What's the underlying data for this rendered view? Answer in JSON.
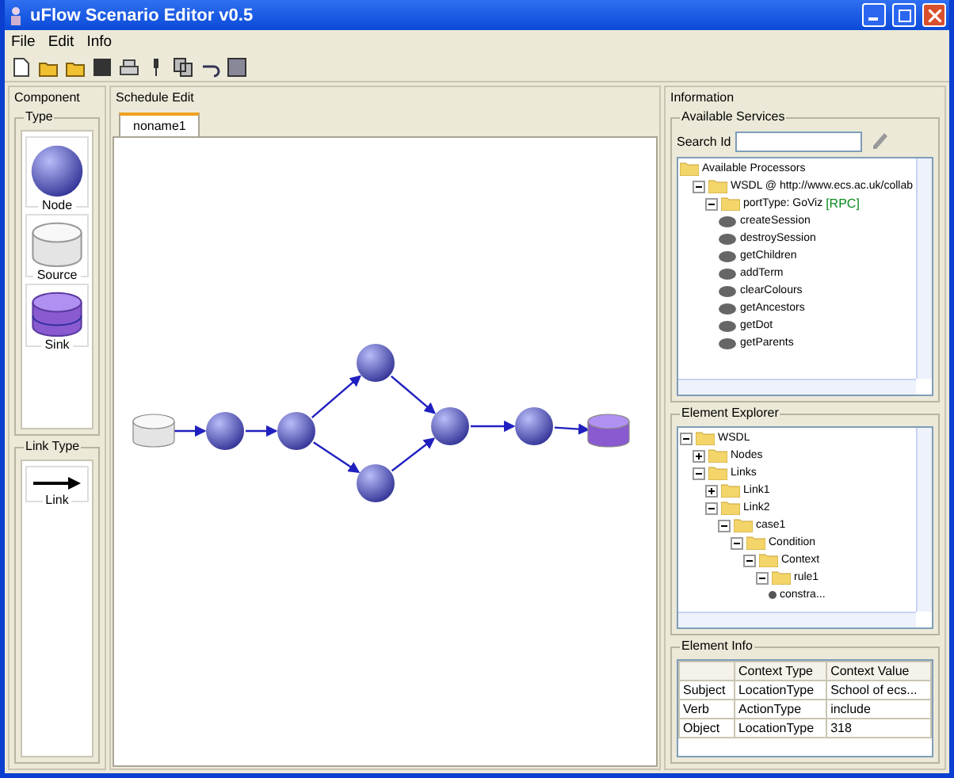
{
  "window": {
    "title": "uFlow Scenario Editor v0.5"
  },
  "menu": [
    "File",
    "Edit",
    "Info"
  ],
  "component": {
    "title": "Component",
    "type_group": "Type",
    "items": [
      {
        "kind": "node",
        "label": "Node"
      },
      {
        "kind": "source",
        "label": "Source"
      },
      {
        "kind": "sink",
        "label": "Sink"
      }
    ],
    "link_group": "Link Type",
    "links": [
      {
        "kind": "arrow",
        "label": "Link"
      }
    ]
  },
  "schedule": {
    "title": "Schedule Edit",
    "tabs": [
      {
        "label": "noname1",
        "selected": true
      }
    ],
    "nodes": [
      {
        "kind": "source"
      },
      {
        "kind": "node"
      },
      {
        "kind": "node"
      },
      {
        "kind": "node"
      },
      {
        "kind": "node"
      },
      {
        "kind": "node"
      },
      {
        "kind": "node"
      },
      {
        "kind": "sink"
      }
    ]
  },
  "information": {
    "title": "Information",
    "services": {
      "title": "Available Services",
      "search_label": "Search Id",
      "tree": [
        {
          "kind": "folder",
          "label": "Available Processors",
          "children": [
            {
              "kind": "folder",
              "label": "WSDL @ http://www.ecs.ac.uk/collab",
              "expanded": true,
              "children": [
                {
                  "kind": "folder",
                  "label": "portType: GoViz",
                  "tag": "[RPC]",
                  "expanded": true,
                  "children": [
                    {
                      "kind": "operation",
                      "label": "createSession"
                    },
                    {
                      "kind": "operation",
                      "label": "destroySession"
                    },
                    {
                      "kind": "operation",
                      "label": "getChildren"
                    },
                    {
                      "kind": "operation",
                      "label": "addTerm"
                    },
                    {
                      "kind": "operation",
                      "label": "clearColours"
                    },
                    {
                      "kind": "operation",
                      "label": "getAncestors"
                    },
                    {
                      "kind": "operation",
                      "label": "getDot"
                    },
                    {
                      "kind": "operation",
                      "label": "getParents"
                    }
                  ]
                }
              ]
            }
          ]
        }
      ]
    },
    "explorer": {
      "title": "Element Explorer",
      "tree": [
        {
          "kind": "folder",
          "label": "WSDL",
          "expanded": true,
          "children": [
            {
              "kind": "folder",
              "label": "Nodes",
              "expanded": false
            },
            {
              "kind": "folder",
              "label": "Links",
              "expanded": true,
              "children": [
                {
                  "kind": "folder",
                  "label": "Link1",
                  "expanded": false
                },
                {
                  "kind": "folder",
                  "label": "Link2",
                  "expanded": true,
                  "children": [
                    {
                      "kind": "folder",
                      "label": "case1",
                      "expanded": true,
                      "children": [
                        {
                          "kind": "folder",
                          "label": "Condition",
                          "expanded": true,
                          "children": [
                            {
                              "kind": "folder",
                              "label": "Context",
                              "expanded": true,
                              "children": [
                                {
                                  "kind": "folder",
                                  "label": "rule1",
                                  "expanded": true,
                                  "children": [
                                    {
                                      "kind": "leaf",
                                      "label": "constra..."
                                    }
                                  ]
                                }
                              ]
                            }
                          ]
                        }
                      ]
                    }
                  ]
                }
              ]
            }
          ]
        }
      ]
    },
    "element_info": {
      "title": "Element Info",
      "columns": [
        "",
        "Context Type",
        "Context Value"
      ],
      "rows": [
        [
          "Subject",
          "LocationType",
          "School of ecs..."
        ],
        [
          "Verb",
          "ActionType",
          "include"
        ],
        [
          "Object",
          "LocationType",
          "318"
        ]
      ]
    }
  }
}
